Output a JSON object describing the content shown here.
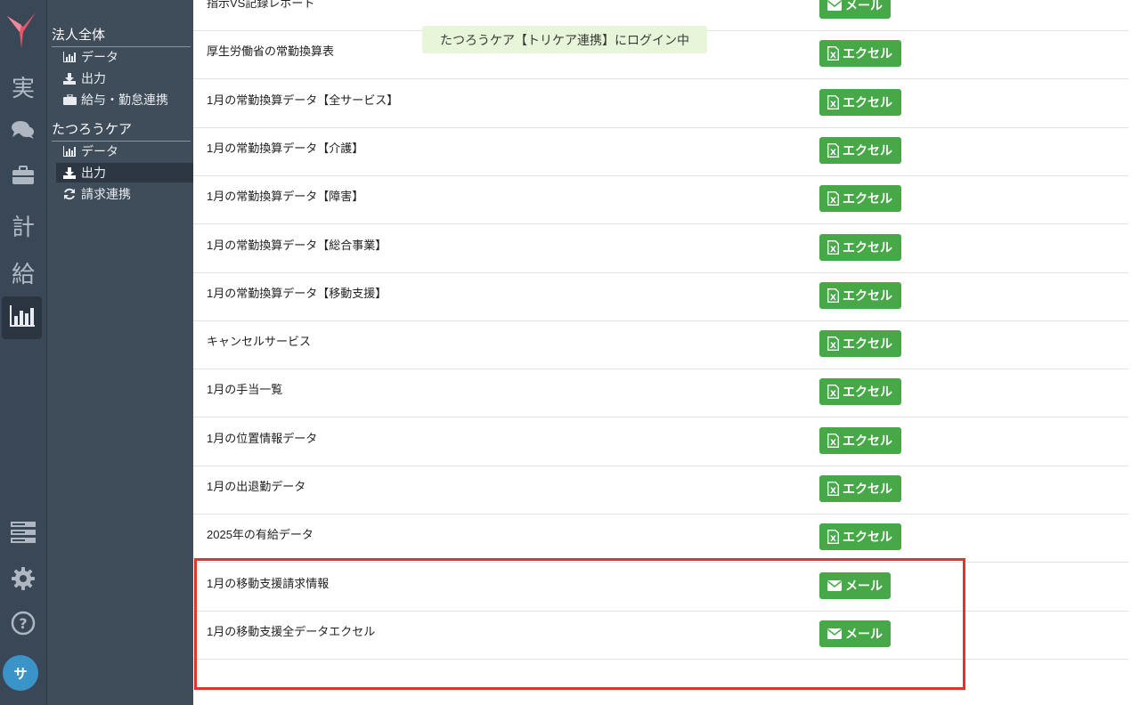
{
  "rail": {
    "items": [
      {
        "char": "実"
      },
      {
        "icon": "comments-icon"
      },
      {
        "icon": "briefcase-icon"
      },
      {
        "char": "計"
      },
      {
        "char": "給"
      },
      {
        "icon": "bar-chart-icon",
        "active": true
      }
    ],
    "bottom": [
      {
        "icon": "server-icon"
      },
      {
        "icon": "gear-icon"
      },
      {
        "icon": "help-icon"
      }
    ],
    "avatar": "サ"
  },
  "subnav": {
    "section1": {
      "title": "法人全体",
      "links": [
        {
          "label": "データ",
          "icon": "bar-chart-icon"
        },
        {
          "label": "出力",
          "icon": "download-icon"
        },
        {
          "label": "給与・勤怠連携",
          "icon": "briefcase-icon"
        }
      ]
    },
    "section2": {
      "title": "たつろうケア",
      "links": [
        {
          "label": "データ",
          "icon": "bar-chart-icon"
        },
        {
          "label": "出力",
          "icon": "download-icon",
          "active": true
        },
        {
          "label": "請求連携",
          "icon": "refresh-icon"
        }
      ]
    }
  },
  "toast": "たつろうケア【トリケア連携】にログイン中",
  "rows": [
    {
      "label": "指示VS記録レポート",
      "button": "メール",
      "type": "mail"
    },
    {
      "label": "厚生労働省の常勤換算表",
      "button": "エクセル",
      "type": "excel"
    },
    {
      "label": "1月の常勤換算データ【全サービス】",
      "button": "エクセル",
      "type": "excel"
    },
    {
      "label": "1月の常勤換算データ【介護】",
      "button": "エクセル",
      "type": "excel"
    },
    {
      "label": "1月の常勤換算データ【障害】",
      "button": "エクセル",
      "type": "excel"
    },
    {
      "label": "1月の常勤換算データ【総合事業】",
      "button": "エクセル",
      "type": "excel"
    },
    {
      "label": "1月の常勤換算データ【移動支援】",
      "button": "エクセル",
      "type": "excel"
    },
    {
      "label": "キャンセルサービス",
      "button": "エクセル",
      "type": "excel"
    },
    {
      "label": "1月の手当一覧",
      "button": "エクセル",
      "type": "excel"
    },
    {
      "label": "1月の位置情報データ",
      "button": "エクセル",
      "type": "excel"
    },
    {
      "label": "1月の出退勤データ",
      "button": "エクセル",
      "type": "excel"
    },
    {
      "label": "2025年の有給データ",
      "button": "エクセル",
      "type": "excel"
    },
    {
      "label": "1月の移動支援請求情報",
      "button": "メール",
      "type": "mail"
    },
    {
      "label": "1月の移動支援全データエクセル",
      "button": "メール",
      "type": "mail"
    }
  ],
  "colors": {
    "rail_bg": "#3a4756",
    "subnav_bg": "#3f4c5a",
    "button_green": "#46a846",
    "toast_bg": "#e7f6d9",
    "highlight_red": "#e0352b",
    "avatar_blue": "#3a94c8"
  }
}
